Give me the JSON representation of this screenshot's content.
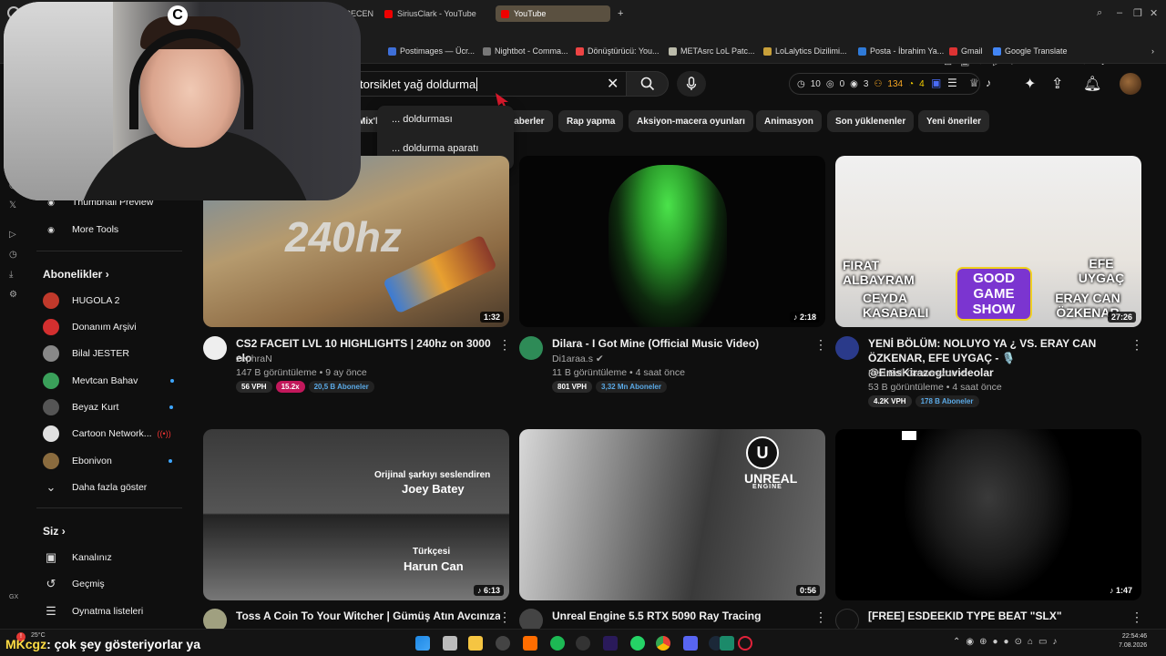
{
  "browser": {
    "tabs": [
      {
        "label": "İSTİRECEN"
      },
      {
        "label": "SiriusClark - YouTube"
      },
      {
        "label": "YouTube"
      }
    ],
    "new_tab_label": "+",
    "bookmarks": [
      {
        "label": "Postimages — Ücr..."
      },
      {
        "label": "Nightbot - Comma..."
      },
      {
        "label": "Dönüştürücü: You..."
      },
      {
        "label": "METAsrc LoL Patc..."
      },
      {
        "label": "LoLalytics Dizilimi..."
      },
      {
        "label": "Posta - İbrahim Ya..."
      },
      {
        "label": "Gmail"
      },
      {
        "label": "Google Translate"
      }
    ]
  },
  "header": {
    "search_value": "torsiklet yağ doldurma",
    "stats": {
      "a": "10",
      "b": "0",
      "c": "3",
      "d": "134",
      "e": "4"
    }
  },
  "suggestions": [
    {
      "label": "... doldurması"
    },
    {
      "label": "... doldurma aparatı"
    }
  ],
  "chips": [
    {
      "label": "Mix'le"
    },
    {
      "label": "Haberler"
    },
    {
      "label": "Rap yapma"
    },
    {
      "label": "Aksiyon-macera oyunları"
    },
    {
      "label": "Animasyon"
    },
    {
      "label": "Son yüklenenler"
    },
    {
      "label": "Yeni öneriler"
    }
  ],
  "sidebar": {
    "tools": [
      {
        "label": "Thumbnail Preview"
      },
      {
        "label": "More Tools"
      }
    ],
    "subs_heading": "Abonelikler",
    "subs": [
      {
        "label": "HUGOLA 2",
        "color": "#c0392b"
      },
      {
        "label": "Donanım Arşivi",
        "color": "#d32f2f"
      },
      {
        "label": "Bilal JESTER",
        "color": "#888888"
      },
      {
        "label": "Mevtcan Bahav",
        "color": "#3aa05a"
      },
      {
        "label": "Beyaz Kurt",
        "color": "#555555"
      },
      {
        "label": "Cartoon Network...",
        "color": "#e0e0e0"
      },
      {
        "label": "Ebonivon",
        "color": "#8a6b3e"
      }
    ],
    "more_label": "Daha fazla göster",
    "you_heading": "Siz",
    "you_items": [
      {
        "label": "Kanalınız"
      },
      {
        "label": "Geçmiş"
      },
      {
        "label": "Oynatma listeleri"
      }
    ]
  },
  "videos": [
    {
      "title": "CS2 FACEIT LVL 10 HIGHLIGHTS | 240hz on 3000 elo",
      "channel": "zephraN",
      "meta": "147 B görüntüleme • 9 ay önce",
      "duration": "1:32",
      "vph": "56 VPH",
      "mult": "15.2x",
      "subs": "20,5 B Aboneler",
      "thumb_text": "240hz"
    },
    {
      "title": "Dilara - I Got Mine (Official Music Video)",
      "channel": "Di1araa.s",
      "meta": "11 B görüntüleme • 4 saat önce",
      "duration": "2:18",
      "vph": "801 VPH",
      "mult": "",
      "subs": "3,32 Mn Aboneler"
    },
    {
      "title": "YENİ BÖLÜM: NOLUYO YA ¿ VS. ERAY CAN ÖZKENAR, EFE UYGAÇ - 🎙️ @EnisKirazogluvideolar",
      "channel": "Red Bull Gamerszon",
      "meta": "53 B görüntüleme • 4 saat önce",
      "duration": "27:26",
      "vph": "4.2K VPH",
      "mult": "",
      "subs": "178 B Aboneler",
      "thumb_names": [
        "FIRAT ALBAYRAM",
        "CEYDA KASABALI",
        "GOOD GAME SHOW",
        "EFE UYGAÇ",
        "ERAY CAN ÖZKENAR"
      ]
    },
    {
      "title": "Toss A Coin To Your Witcher | Gümüş Atın Avcınıza |",
      "duration": "6:13",
      "thumb_top": "Orijinal şarkıyı seslendiren",
      "thumb_top_name": "Joey Batey",
      "thumb_bottom": "Türkçesi",
      "thumb_bottom_name": "Harun Can"
    },
    {
      "title": "Unreal Engine 5.5 RTX 5090 Ray Tracing",
      "duration": "0:56",
      "thumb_logo": "UNREAL",
      "thumb_logo_sub": "ENGINE"
    },
    {
      "title": "[FREE] ESDEEKID TYPE BEAT \"SLX\"",
      "duration": "1:47"
    }
  ],
  "taskbar": {
    "weather": "25°C",
    "chat_user": "MKcgz",
    "chat_msg": ": çok şey gösteriyorlar ya",
    "time": "22:54:46",
    "date": "7.08.2026"
  },
  "left_rail": {
    "gx_label": "GX"
  }
}
